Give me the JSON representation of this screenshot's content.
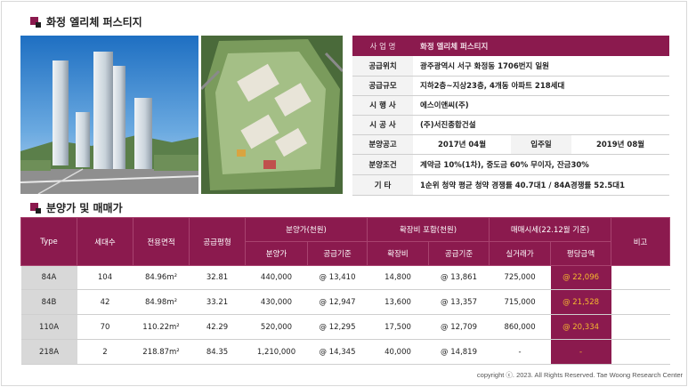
{
  "section1": {
    "title": "화정 엘리체 퍼스티지"
  },
  "section2": {
    "title": "분양가 및 매매가"
  },
  "info": {
    "rows": [
      {
        "label": "사 업 명",
        "value": "화정 엘리체 퍼스티지"
      },
      {
        "label": "공급위치",
        "value": "광주광역시 서구 화정동 1706번지 일원"
      },
      {
        "label": "공급규모",
        "value": "지하2층~지상23층, 4개동 아파트 218세대"
      },
      {
        "label": "시 행 사",
        "value": "에스이앤씨(주)"
      },
      {
        "label": "시 공 사",
        "value": "(주)서진종합건설"
      }
    ],
    "sale": {
      "label": "분양공고",
      "value": "2017년 04월",
      "label2": "입주일",
      "value2": "2019년 08월"
    },
    "terms": {
      "label": "분양조건",
      "value": "계약금 10%(1차), 중도금 60% 무이자, 잔금30%"
    },
    "etc": {
      "label": "기 타",
      "value": "1순위 청약 평균 청약 경쟁률 40.7대1 / 84A경쟁률 52.5대1"
    }
  },
  "sales_table": {
    "headers": {
      "type": "Type",
      "units": "세대수",
      "area": "전용면적",
      "pyeong": "공급평형",
      "group_sale": "분양가(천원)",
      "group_ext": "확장비 포함(천원)",
      "group_market": "매매시세(22.12월 기준)",
      "note": "비고",
      "sale_price": "분양가",
      "sale_unit": "공급기준",
      "ext_cost": "확장비",
      "ext_unit": "공급기준",
      "market_price": "실거래가",
      "market_unit": "평당금액"
    },
    "rows": [
      {
        "type": "84A",
        "units": "104",
        "area": "84.96m²",
        "pyeong": "32.81",
        "sale_price": "440,000",
        "sale_unit": "@ 13,410",
        "ext_cost": "14,800",
        "ext_unit": "@ 13,861",
        "market_price": "725,000",
        "market_unit": "@ 22,096",
        "note": ""
      },
      {
        "type": "84B",
        "units": "42",
        "area": "84.98m²",
        "pyeong": "33.21",
        "sale_price": "430,000",
        "sale_unit": "@ 12,947",
        "ext_cost": "13,600",
        "ext_unit": "@ 13,357",
        "market_price": "715,000",
        "market_unit": "@ 21,528",
        "note": ""
      },
      {
        "type": "110A",
        "units": "70",
        "area": "110.22m²",
        "pyeong": "42.29",
        "sale_price": "520,000",
        "sale_unit": "@ 12,295",
        "ext_cost": "17,500",
        "ext_unit": "@ 12,709",
        "market_price": "860,000",
        "market_unit": "@ 20,334",
        "note": ""
      },
      {
        "type": "218A",
        "units": "2",
        "area": "218.87m²",
        "pyeong": "84.35",
        "sale_price": "1,210,000",
        "sale_unit": "@ 14,345",
        "ext_cost": "40,000",
        "ext_unit": "@ 14,819",
        "market_price": "-",
        "market_unit": "-",
        "note": ""
      }
    ]
  },
  "footer": {
    "copyright": "copyright ⓒ. 2023. All Rights Reserved. Tae Woong Research Center"
  },
  "colors": {
    "accent": "#8b1a4e",
    "highlight_text": "#f5b82e",
    "type_cell": "#d8d8d8"
  }
}
